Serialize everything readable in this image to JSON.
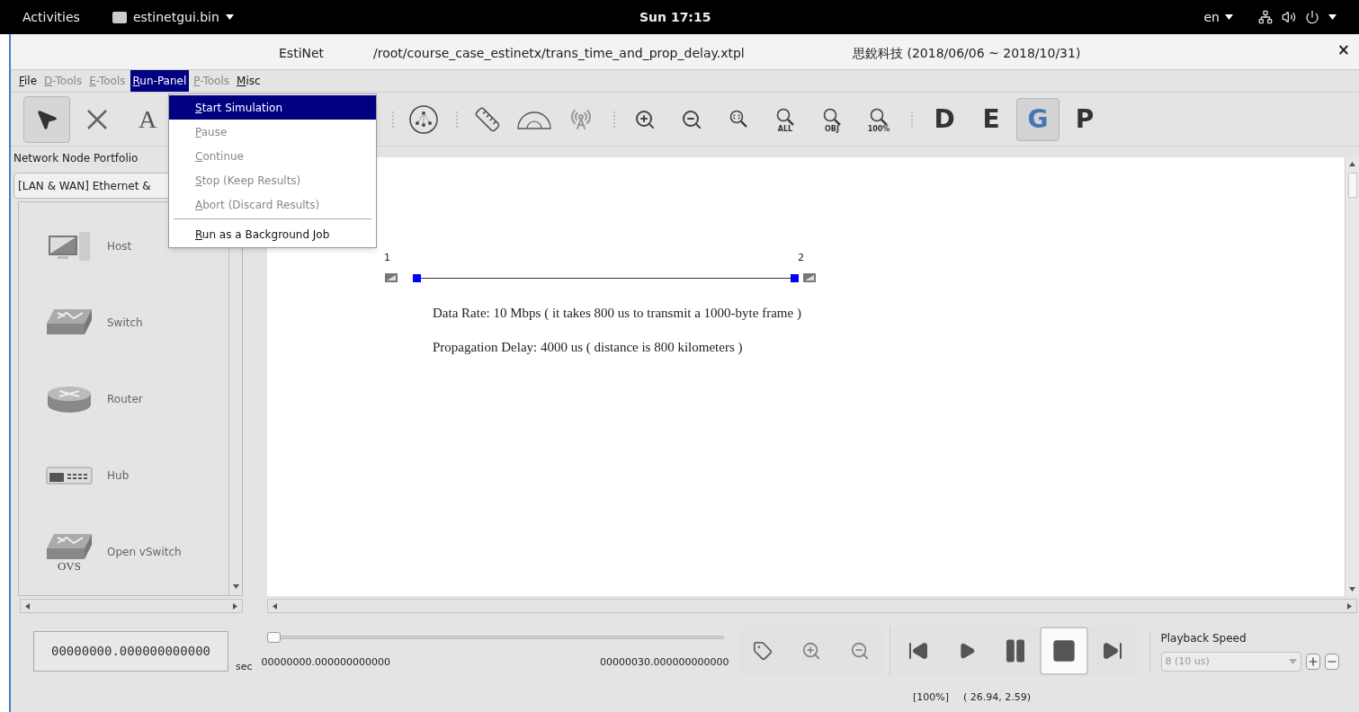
{
  "top_bar": {
    "activities": "Activities",
    "app": "estinetgui.bin",
    "clock": "Sun 17:15",
    "language": "en"
  },
  "window": {
    "app_name": "EstiNet",
    "file_path": "/root/course_case_estinetx/trans_time_and_prop_delay.xtpl",
    "license": "思銳科技 (2018/06/06 ~ 2018/10/31)",
    "close": "×"
  },
  "menu_bar": [
    {
      "label": "File",
      "selected": false,
      "disabled": false
    },
    {
      "label": "D-Tools",
      "selected": false,
      "disabled": true
    },
    {
      "label": "E-Tools",
      "selected": false,
      "disabled": true
    },
    {
      "label": "Run-Panel",
      "selected": true,
      "disabled": false
    },
    {
      "label": "P-Tools",
      "selected": false,
      "disabled": true
    },
    {
      "label": "Misc",
      "selected": false,
      "disabled": false
    }
  ],
  "menu_groups": [
    [
      {
        "label": "Start Simulation",
        "selected": true,
        "disabled": false
      },
      {
        "label": "Pause",
        "selected": false,
        "disabled": true
      },
      {
        "label": "Continue",
        "selected": false,
        "disabled": true
      },
      {
        "label": "Stop (Keep Results)",
        "selected": false,
        "disabled": true
      },
      {
        "label": "Abort (Discard Results)",
        "selected": false,
        "disabled": true
      }
    ],
    [
      {
        "label": "Run as a Background Job",
        "selected": false,
        "disabled": false
      }
    ]
  ],
  "toolbar": {
    "tools": [
      {
        "kind": "pointer",
        "selected": true
      },
      {
        "kind": "link",
        "selected": false
      },
      {
        "kind": "text",
        "label": "A",
        "selected": false
      }
    ],
    "groups": [
      [
        {
          "kind": "subnet"
        }
      ],
      [
        {
          "kind": "ruler"
        },
        {
          "kind": "protractor"
        },
        {
          "kind": "antenna"
        }
      ],
      [
        {
          "kind": "zoom-in"
        },
        {
          "kind": "zoom-out"
        },
        {
          "kind": "zoom-fit"
        },
        {
          "kind": "zoom-label",
          "label": "ALL"
        },
        {
          "kind": "zoom-label",
          "label": "OBJ"
        },
        {
          "kind": "zoom-label",
          "label": "100%"
        }
      ]
    ],
    "modes": [
      {
        "label": "D",
        "selected": false
      },
      {
        "label": "E",
        "selected": false
      },
      {
        "label": "G",
        "selected": true
      },
      {
        "label": "P",
        "selected": false
      }
    ]
  },
  "palette": {
    "title": "Network Node Portfolio",
    "category": "[LAN & WAN] Ethernet &",
    "items": [
      {
        "kind": "host",
        "label": "Host"
      },
      {
        "kind": "switch",
        "label": "Switch"
      },
      {
        "kind": "router",
        "label": "Router"
      },
      {
        "kind": "hub",
        "label": "Hub"
      },
      {
        "kind": "ovs",
        "label": "Open vSwitch",
        "badge": "OVS"
      }
    ]
  },
  "canvas": {
    "nodes": [
      {
        "label": "1"
      },
      {
        "label": "2"
      }
    ],
    "notes": [
      "Data Rate: 10 Mbps ( it takes 800 us to transmit a 1000-byte frame )",
      "Propagation Delay: 4000 us ( distance is 800 kilometers )"
    ]
  },
  "playback": {
    "time": "00000000.000000000000",
    "unit": "sec",
    "start": "00000000.000000000000",
    "end": "00000030.000000000000",
    "level": 0,
    "controls": [
      [
        {
          "kind": "tag",
          "selected": false
        },
        {
          "kind": "zoom-in",
          "selected": false
        },
        {
          "kind": "zoom-out",
          "selected": false
        }
      ],
      [
        {
          "kind": "skip-back",
          "selected": false
        },
        {
          "kind": "play",
          "selected": false
        },
        {
          "kind": "pause",
          "selected": false
        },
        {
          "kind": "stop",
          "selected": true
        },
        {
          "kind": "skip-forward",
          "selected": false
        }
      ]
    ],
    "speed_label": "Playback Speed",
    "speed": "8 (10 us)"
  },
  "status": {
    "zoom": "[100%]",
    "coords": "( 26.94, 2.59)"
  }
}
